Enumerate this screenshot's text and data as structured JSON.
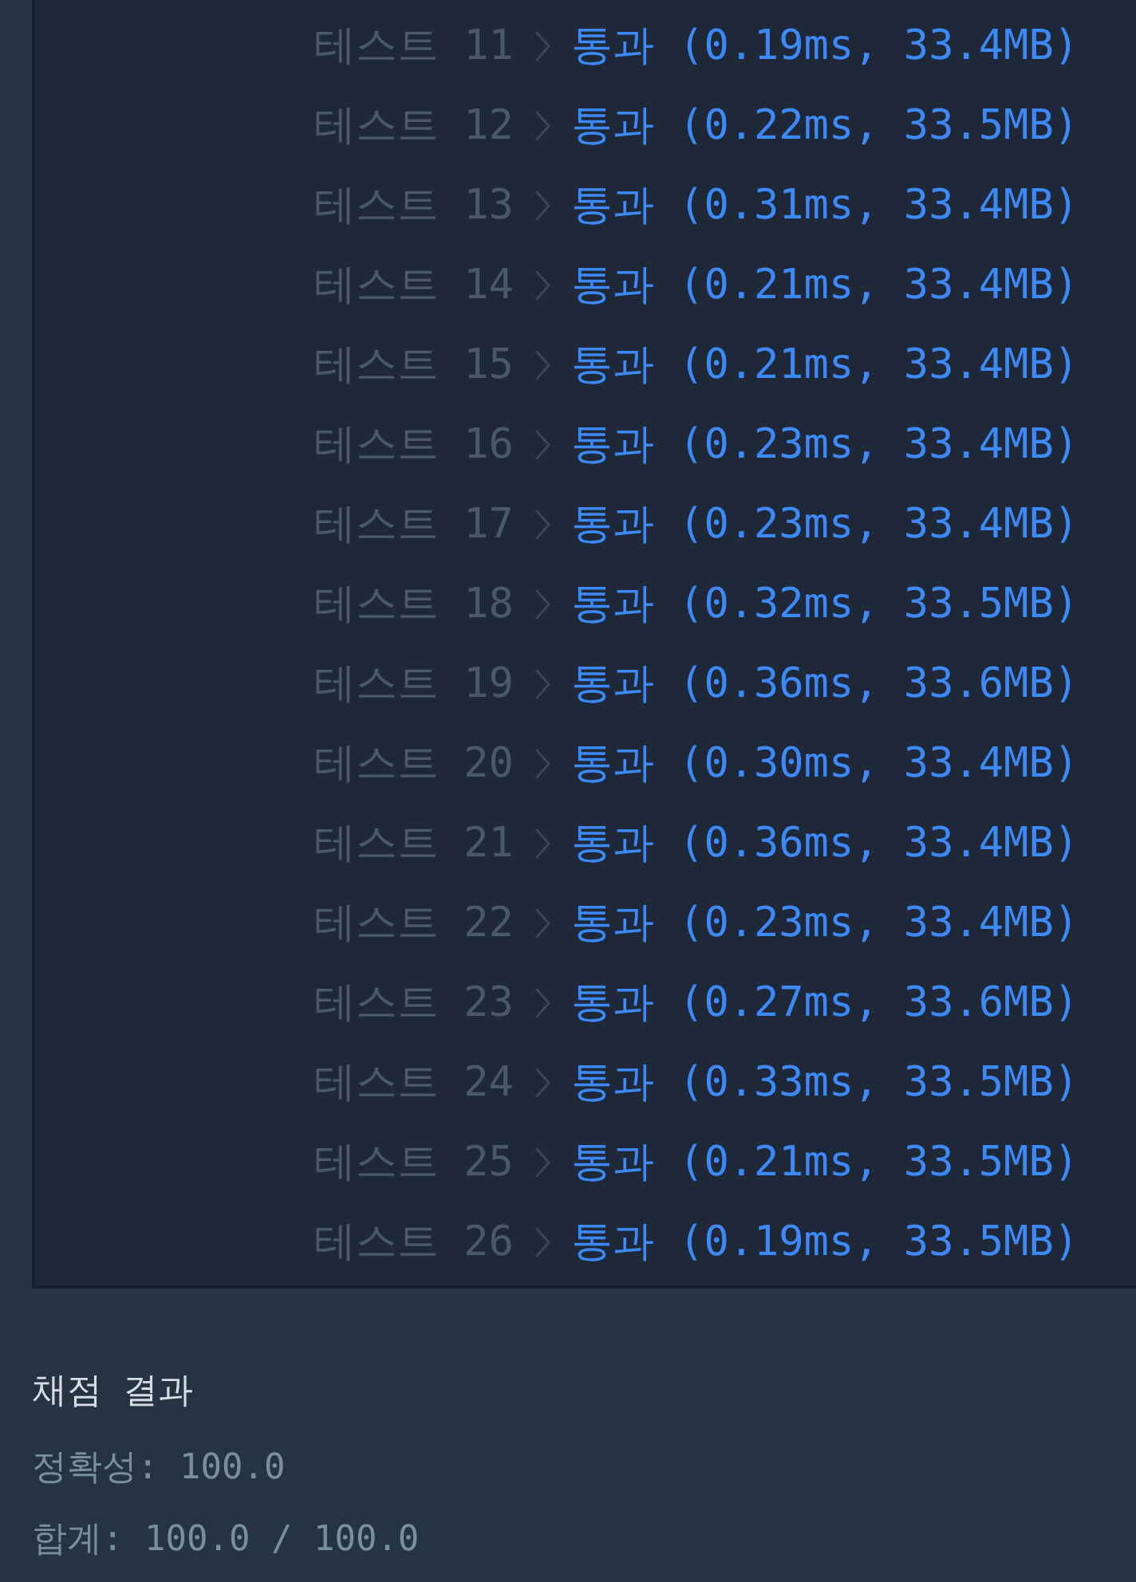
{
  "tests": [
    {
      "label": "테스트 11",
      "result": "통과 (0.19ms, 33.4MB)"
    },
    {
      "label": "테스트 12",
      "result": "통과 (0.22ms, 33.5MB)"
    },
    {
      "label": "테스트 13",
      "result": "통과 (0.31ms, 33.4MB)"
    },
    {
      "label": "테스트 14",
      "result": "통과 (0.21ms, 33.4MB)"
    },
    {
      "label": "테스트 15",
      "result": "통과 (0.21ms, 33.4MB)"
    },
    {
      "label": "테스트 16",
      "result": "통과 (0.23ms, 33.4MB)"
    },
    {
      "label": "테스트 17",
      "result": "통과 (0.23ms, 33.4MB)"
    },
    {
      "label": "테스트 18",
      "result": "통과 (0.32ms, 33.5MB)"
    },
    {
      "label": "테스트 19",
      "result": "통과 (0.36ms, 33.6MB)"
    },
    {
      "label": "테스트 20",
      "result": "통과 (0.30ms, 33.4MB)"
    },
    {
      "label": "테스트 21",
      "result": "통과 (0.36ms, 33.4MB)"
    },
    {
      "label": "테스트 22",
      "result": "통과 (0.23ms, 33.4MB)"
    },
    {
      "label": "테스트 23",
      "result": "통과 (0.27ms, 33.6MB)"
    },
    {
      "label": "테스트 24",
      "result": "통과 (0.33ms, 33.5MB)"
    },
    {
      "label": "테스트 25",
      "result": "통과 (0.21ms, 33.5MB)"
    },
    {
      "label": "테스트 26",
      "result": "통과 (0.19ms, 33.5MB)"
    }
  ],
  "grading": {
    "title": "채점 결과",
    "lines": [
      "정확성: 100.0",
      "합계: 100.0 / 100.0"
    ]
  }
}
